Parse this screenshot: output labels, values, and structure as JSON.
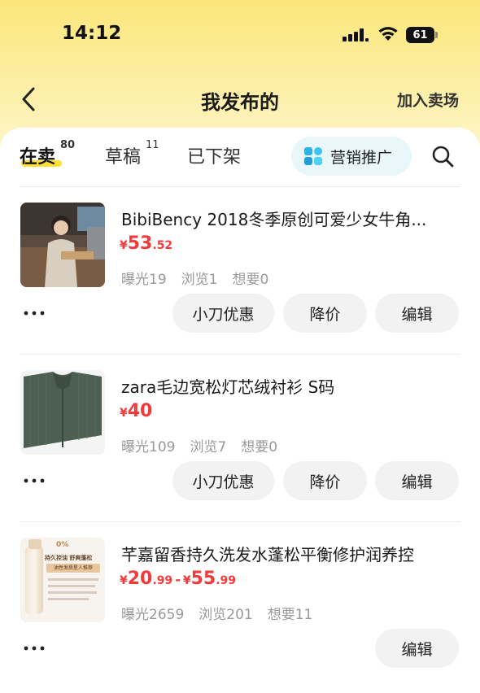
{
  "status_bar": {
    "time": "14:12",
    "battery": "61"
  },
  "nav": {
    "title": "我发布的",
    "action": "加入卖场"
  },
  "tabs": [
    {
      "label": "在卖",
      "count": "80"
    },
    {
      "label": "草稿",
      "count": "11"
    },
    {
      "label": "已下架",
      "count": ""
    }
  ],
  "promo": {
    "label": "营销推广"
  },
  "actions": {
    "coupon": "小刀优惠",
    "reduce": "降价",
    "edit": "编辑"
  },
  "items": [
    {
      "title": "BibiBency 2018冬季原创可爱少女牛角...",
      "price_yen": "¥",
      "price_int": "53",
      "price_dec": ".52",
      "exposure": "曝光19",
      "views": "浏览1",
      "wants": "想要0"
    },
    {
      "title": "zara毛边宽松灯芯绒衬衫 S码",
      "price_yen": "¥",
      "price_int": "40",
      "price_dec": "",
      "exposure": "曝光109",
      "views": "浏览7",
      "wants": "想要0"
    },
    {
      "title": "芊嘉留香持久洗发水蓬松平衡修护润养控",
      "price_yen": "¥",
      "price_int": "20",
      "price_dec": ".99",
      "price_sep": "-",
      "price2_yen": "¥",
      "price2_int": "55",
      "price2_dec": ".99",
      "exposure": "曝光2659",
      "views": "浏览201",
      "wants": "想要11",
      "thumb_text": {
        "line1": "持久控油 舒爽蓬松",
        "line2": "油性发质星人推荐",
        "badge": "0%"
      }
    }
  ],
  "colors": {
    "accent_yellow": "#ffe033",
    "price_red": "#f23a3a",
    "promo_bg": "#e9f7fb"
  }
}
